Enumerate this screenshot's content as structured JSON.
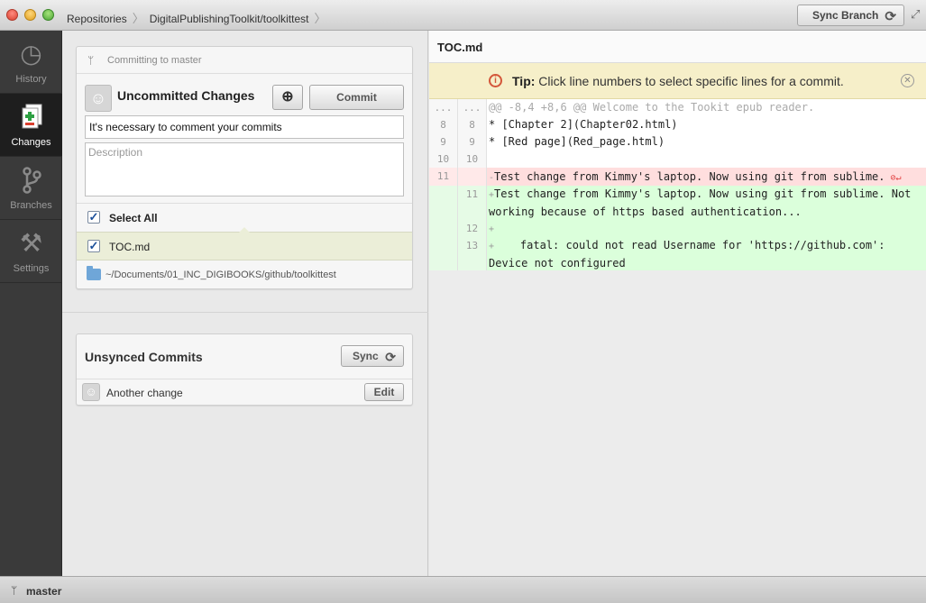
{
  "titlebar": {
    "breadcrumbs": [
      "Repositories",
      "DigitalPublishingToolkit/toolkittest"
    ],
    "sync_branch_label": "Sync Branch"
  },
  "nav": {
    "items": [
      {
        "label": "History",
        "icon": "history-icon",
        "active": false
      },
      {
        "label": "Changes",
        "icon": "changes-icon",
        "active": true
      },
      {
        "label": "Branches",
        "icon": "branches-icon",
        "active": false
      },
      {
        "label": "Settings",
        "icon": "settings-icon",
        "active": false
      }
    ]
  },
  "changes": {
    "committing_to": "Committing to master",
    "title": "Uncommitted Changes",
    "commit_label": "Commit",
    "summary_value": "It's necessary to comment your commits",
    "description_placeholder": "Description",
    "select_all_label": "Select All",
    "files": [
      {
        "name": "TOC.md",
        "checked": true
      }
    ],
    "repo_path": "~/Documents/01_INC_DIGIBOOKS/github/toolkittest"
  },
  "unsynced": {
    "title": "Unsynced Commits",
    "sync_label": "Sync",
    "commits": [
      {
        "message": "Another change",
        "edit_label": "Edit"
      }
    ]
  },
  "diff": {
    "file_title": "TOC.md",
    "tip_bold": "Tip:",
    "tip_text": "Click line numbers to select specific lines for a commit.",
    "lines": [
      {
        "type": "hunk",
        "old": "...",
        "new": "...",
        "marker": "",
        "text": "@@ -8,4 +8,6 @@ Welcome to the Tookit epub reader."
      },
      {
        "type": "ctx",
        "old": "8",
        "new": "8",
        "marker": "",
        "text": "* [Chapter 2](Chapter02.html)"
      },
      {
        "type": "ctx",
        "old": "9",
        "new": "9",
        "marker": "",
        "text": "* [Red page](Red_page.html)"
      },
      {
        "type": "ctx",
        "old": "10",
        "new": "10",
        "marker": "",
        "text": ""
      },
      {
        "type": "del",
        "old": "11",
        "new": "",
        "marker": "-",
        "text": "Test change from Kimmy's laptop. Now using git from sublime."
      },
      {
        "type": "add",
        "old": "",
        "new": "11",
        "marker": "+",
        "text": "Test change from Kimmy's laptop. Now using git from sublime. Not working because of https based authentication..."
      },
      {
        "type": "add",
        "old": "",
        "new": "12",
        "marker": "+",
        "text": ""
      },
      {
        "type": "add",
        "old": "",
        "new": "13",
        "marker": "+",
        "text": "    fatal: could not read Username for 'https://github.com': Device not configured"
      }
    ]
  },
  "status": {
    "branch": "master"
  },
  "colors": {
    "accent": "#1b4f9a",
    "deleted_bg": "#ffdede",
    "added_bg": "#dbffdb",
    "tip_bg": "#f6efc9"
  }
}
